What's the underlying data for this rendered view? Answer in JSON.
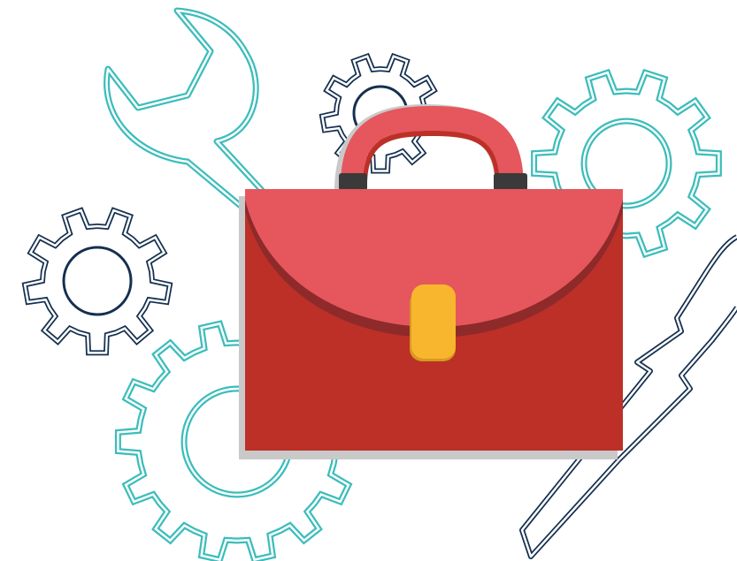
{
  "illustration": {
    "subject": "briefcase-with-tools",
    "icons": [
      "wrench-icon",
      "gear-icon",
      "screwdriver-icon",
      "briefcase-icon"
    ],
    "colors": {
      "teal_outline": "#3bbdbb",
      "navy_outline": "#15304f",
      "briefcase_top": "#e6565d",
      "briefcase_body": "#bd3027",
      "briefcase_shadow": "#8e2a2a",
      "handle": "#e6565d",
      "handle_fastener": "#3a3a3a",
      "clasp": "#f8b62e",
      "drop_shadow": "#c9c9c9",
      "background": "#ffffff"
    }
  }
}
